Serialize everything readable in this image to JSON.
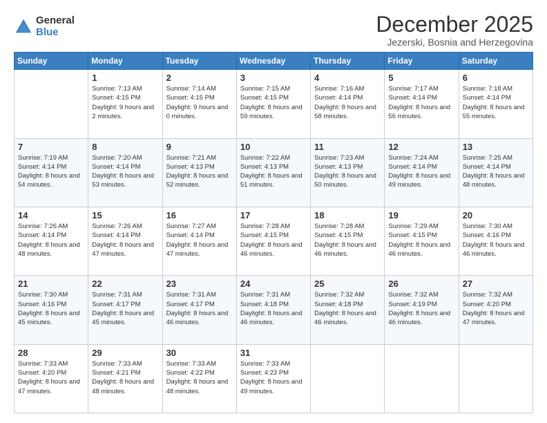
{
  "logo": {
    "general": "General",
    "blue": "Blue"
  },
  "title": "December 2025",
  "subtitle": "Jezerski, Bosnia and Herzegovina",
  "weekdays": [
    "Sunday",
    "Monday",
    "Tuesday",
    "Wednesday",
    "Thursday",
    "Friday",
    "Saturday"
  ],
  "weeks": [
    [
      {
        "day": "",
        "sunrise": "",
        "sunset": "",
        "daylight": ""
      },
      {
        "day": "1",
        "sunrise": "Sunrise: 7:13 AM",
        "sunset": "Sunset: 4:15 PM",
        "daylight": "Daylight: 9 hours and 2 minutes."
      },
      {
        "day": "2",
        "sunrise": "Sunrise: 7:14 AM",
        "sunset": "Sunset: 4:15 PM",
        "daylight": "Daylight: 9 hours and 0 minutes."
      },
      {
        "day": "3",
        "sunrise": "Sunrise: 7:15 AM",
        "sunset": "Sunset: 4:15 PM",
        "daylight": "Daylight: 8 hours and 59 minutes."
      },
      {
        "day": "4",
        "sunrise": "Sunrise: 7:16 AM",
        "sunset": "Sunset: 4:14 PM",
        "daylight": "Daylight: 8 hours and 58 minutes."
      },
      {
        "day": "5",
        "sunrise": "Sunrise: 7:17 AM",
        "sunset": "Sunset: 4:14 PM",
        "daylight": "Daylight: 8 hours and 56 minutes."
      },
      {
        "day": "6",
        "sunrise": "Sunrise: 7:18 AM",
        "sunset": "Sunset: 4:14 PM",
        "daylight": "Daylight: 8 hours and 55 minutes."
      }
    ],
    [
      {
        "day": "7",
        "sunrise": "Sunrise: 7:19 AM",
        "sunset": "Sunset: 4:14 PM",
        "daylight": "Daylight: 8 hours and 54 minutes."
      },
      {
        "day": "8",
        "sunrise": "Sunrise: 7:20 AM",
        "sunset": "Sunset: 4:14 PM",
        "daylight": "Daylight: 8 hours and 53 minutes."
      },
      {
        "day": "9",
        "sunrise": "Sunrise: 7:21 AM",
        "sunset": "Sunset: 4:13 PM",
        "daylight": "Daylight: 8 hours and 52 minutes."
      },
      {
        "day": "10",
        "sunrise": "Sunrise: 7:22 AM",
        "sunset": "Sunset: 4:13 PM",
        "daylight": "Daylight: 8 hours and 51 minutes."
      },
      {
        "day": "11",
        "sunrise": "Sunrise: 7:23 AM",
        "sunset": "Sunset: 4:13 PM",
        "daylight": "Daylight: 8 hours and 50 minutes."
      },
      {
        "day": "12",
        "sunrise": "Sunrise: 7:24 AM",
        "sunset": "Sunset: 4:14 PM",
        "daylight": "Daylight: 8 hours and 49 minutes."
      },
      {
        "day": "13",
        "sunrise": "Sunrise: 7:25 AM",
        "sunset": "Sunset: 4:14 PM",
        "daylight": "Daylight: 8 hours and 48 minutes."
      }
    ],
    [
      {
        "day": "14",
        "sunrise": "Sunrise: 7:26 AM",
        "sunset": "Sunset: 4:14 PM",
        "daylight": "Daylight: 8 hours and 48 minutes."
      },
      {
        "day": "15",
        "sunrise": "Sunrise: 7:26 AM",
        "sunset": "Sunset: 4:14 PM",
        "daylight": "Daylight: 8 hours and 47 minutes."
      },
      {
        "day": "16",
        "sunrise": "Sunrise: 7:27 AM",
        "sunset": "Sunset: 4:14 PM",
        "daylight": "Daylight: 8 hours and 47 minutes."
      },
      {
        "day": "17",
        "sunrise": "Sunrise: 7:28 AM",
        "sunset": "Sunset: 4:15 PM",
        "daylight": "Daylight: 8 hours and 46 minutes."
      },
      {
        "day": "18",
        "sunrise": "Sunrise: 7:28 AM",
        "sunset": "Sunset: 4:15 PM",
        "daylight": "Daylight: 8 hours and 46 minutes."
      },
      {
        "day": "19",
        "sunrise": "Sunrise: 7:29 AM",
        "sunset": "Sunset: 4:15 PM",
        "daylight": "Daylight: 8 hours and 46 minutes."
      },
      {
        "day": "20",
        "sunrise": "Sunrise: 7:30 AM",
        "sunset": "Sunset: 4:16 PM",
        "daylight": "Daylight: 8 hours and 46 minutes."
      }
    ],
    [
      {
        "day": "21",
        "sunrise": "Sunrise: 7:30 AM",
        "sunset": "Sunset: 4:16 PM",
        "daylight": "Daylight: 8 hours and 45 minutes."
      },
      {
        "day": "22",
        "sunrise": "Sunrise: 7:31 AM",
        "sunset": "Sunset: 4:17 PM",
        "daylight": "Daylight: 8 hours and 45 minutes."
      },
      {
        "day": "23",
        "sunrise": "Sunrise: 7:31 AM",
        "sunset": "Sunset: 4:17 PM",
        "daylight": "Daylight: 8 hours and 46 minutes."
      },
      {
        "day": "24",
        "sunrise": "Sunrise: 7:31 AM",
        "sunset": "Sunset: 4:18 PM",
        "daylight": "Daylight: 8 hours and 46 minutes."
      },
      {
        "day": "25",
        "sunrise": "Sunrise: 7:32 AM",
        "sunset": "Sunset: 4:18 PM",
        "daylight": "Daylight: 8 hours and 46 minutes."
      },
      {
        "day": "26",
        "sunrise": "Sunrise: 7:32 AM",
        "sunset": "Sunset: 4:19 PM",
        "daylight": "Daylight: 8 hours and 46 minutes."
      },
      {
        "day": "27",
        "sunrise": "Sunrise: 7:32 AM",
        "sunset": "Sunset: 4:20 PM",
        "daylight": "Daylight: 8 hours and 47 minutes."
      }
    ],
    [
      {
        "day": "28",
        "sunrise": "Sunrise: 7:33 AM",
        "sunset": "Sunset: 4:20 PM",
        "daylight": "Daylight: 8 hours and 47 minutes."
      },
      {
        "day": "29",
        "sunrise": "Sunrise: 7:33 AM",
        "sunset": "Sunset: 4:21 PM",
        "daylight": "Daylight: 8 hours and 48 minutes."
      },
      {
        "day": "30",
        "sunrise": "Sunrise: 7:33 AM",
        "sunset": "Sunset: 4:22 PM",
        "daylight": "Daylight: 8 hours and 48 minutes."
      },
      {
        "day": "31",
        "sunrise": "Sunrise: 7:33 AM",
        "sunset": "Sunset: 4:23 PM",
        "daylight": "Daylight: 8 hours and 49 minutes."
      },
      {
        "day": "",
        "sunrise": "",
        "sunset": "",
        "daylight": ""
      },
      {
        "day": "",
        "sunrise": "",
        "sunset": "",
        "daylight": ""
      },
      {
        "day": "",
        "sunrise": "",
        "sunset": "",
        "daylight": ""
      }
    ]
  ]
}
